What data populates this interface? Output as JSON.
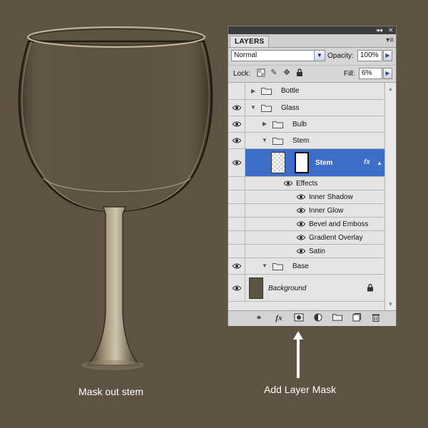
{
  "colors": {
    "background": "#5e5242",
    "panel": "#d6d6d6",
    "selection": "#3c6ec8",
    "titlebar": "#3d3d3d"
  },
  "captions": {
    "left": "Mask out stem",
    "right": "Add Layer Mask"
  },
  "panel": {
    "tab_label": "LAYERS",
    "titlebar_icons": [
      "collapse-icon",
      "close-icon"
    ],
    "menu_icon": "panel-menu-icon",
    "blend_mode": "Normal",
    "opacity_label": "Opacity:",
    "opacity_value": "100%",
    "lock_label": "Lock:",
    "lock_icons": [
      "lock-transparent-icon",
      "lock-image-icon",
      "lock-position-icon",
      "lock-all-icon"
    ],
    "fill_label": "Fill:",
    "fill_value": "6%",
    "layers": [
      {
        "name": "Bottle",
        "type": "group",
        "expanded": false,
        "visible": false
      },
      {
        "name": "Glass",
        "type": "group",
        "expanded": true,
        "visible": true
      },
      {
        "name": "Bulb",
        "type": "group",
        "expanded": false,
        "visible": true
      },
      {
        "name": "Stem",
        "type": "group",
        "expanded": true,
        "visible": true
      },
      {
        "name": "Stem",
        "type": "layer",
        "selected": true,
        "visible": true,
        "fx_label": "fx"
      },
      {
        "name": "Effects",
        "type": "effects-header",
        "visible": true
      },
      {
        "name": "Inner Shadow",
        "type": "effect",
        "visible": true
      },
      {
        "name": "Inner Glow",
        "type": "effect",
        "visible": true
      },
      {
        "name": "Bevel and Emboss",
        "type": "effect",
        "visible": true
      },
      {
        "name": "Gradient Overlay",
        "type": "effect",
        "visible": true
      },
      {
        "name": "Satin",
        "type": "effect",
        "visible": true
      },
      {
        "name": "Base",
        "type": "group",
        "expanded": false,
        "visible": true
      },
      {
        "name": "Background",
        "type": "background",
        "visible": true,
        "locked": true
      }
    ],
    "footer_icons": [
      "link-layers-icon",
      "fx-icon",
      "add-layer-mask-icon",
      "adjustment-layer-icon",
      "new-group-icon",
      "new-layer-icon",
      "delete-layer-icon"
    ]
  }
}
